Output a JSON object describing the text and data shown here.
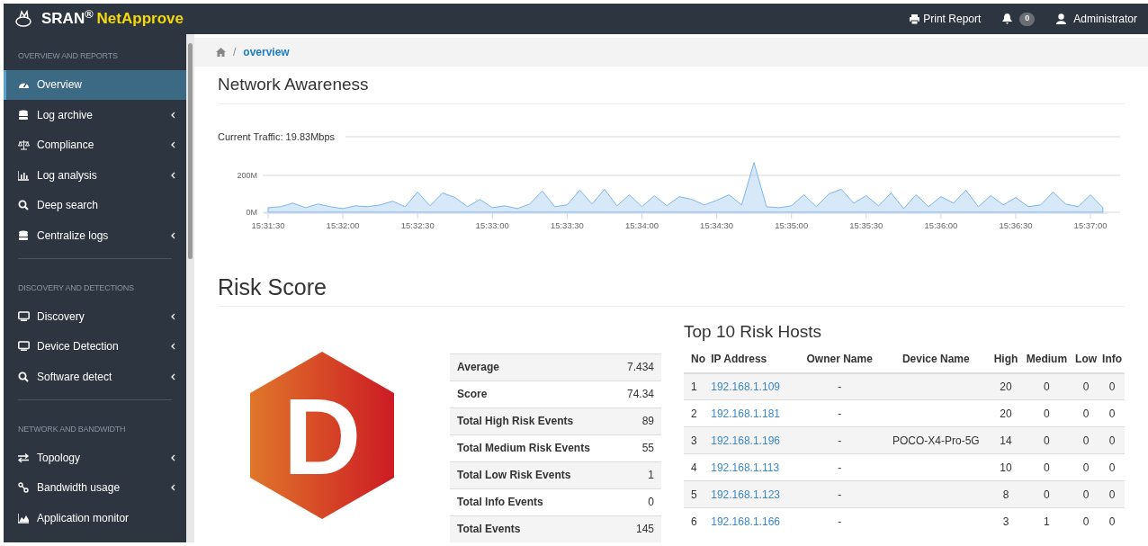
{
  "header": {
    "brand": "SRAN$^{®}$",
    "product": "NetApprove",
    "actions": [
      {
        "kind": "print",
        "label": "Print Report"
      },
      {
        "kind": "bell",
        "count": "0"
      },
      {
        "kind": "user",
        "label": "Administrator"
      }
    ]
  },
  "sidebar": {
    "items": [
      {
        "kind": "header",
        "label": "OVERVIEW AND REPORTS"
      },
      {
        "kind": "item",
        "label": "Overview",
        "selected": true,
        "submenu": false
      },
      {
        "kind": "item",
        "label": "Log archive",
        "selected": false,
        "submenu": true
      },
      {
        "kind": "item",
        "label": "Compliance",
        "selected": false,
        "submenu": true
      },
      {
        "kind": "item",
        "label": "Log analysis",
        "selected": false,
        "submenu": true
      },
      {
        "kind": "item",
        "label": "Deep search",
        "selected": false,
        "submenu": false
      },
      {
        "kind": "item",
        "label": "Centralize logs",
        "selected": false,
        "submenu": true
      },
      {
        "kind": "divider"
      },
      {
        "kind": "header",
        "label": "DISCOVERY AND DETECTIONS"
      },
      {
        "kind": "item",
        "label": "Discovery",
        "selected": false,
        "submenu": true
      },
      {
        "kind": "item",
        "label": "Device Detection",
        "selected": false,
        "submenu": true
      },
      {
        "kind": "item",
        "label": "Software detect",
        "selected": false,
        "submenu": true
      },
      {
        "kind": "divider"
      },
      {
        "kind": "header",
        "label": "NETWORK AND BANDWIDTH"
      },
      {
        "kind": "item",
        "label": "Topology",
        "selected": false,
        "submenu": true
      },
      {
        "kind": "item",
        "label": "Bandwidth usage",
        "selected": false,
        "submenu": true
      },
      {
        "kind": "item",
        "label": "Application monitor",
        "selected": false,
        "submenu": false
      }
    ]
  },
  "breadcrumb": {
    "separator": "/",
    "current": "overview"
  },
  "network": {
    "title": "Network Awareness",
    "chart_data": {
      "type": "area",
      "title": "Current Traffic: 19.83Mbps",
      "categories": [
        "15:31:30",
        null,
        null,
        null,
        null,
        null,
        "15:32:00",
        null,
        null,
        null,
        null,
        null,
        "15:32:30",
        null,
        null,
        null,
        null,
        null,
        "15:33:00",
        null,
        null,
        null,
        null,
        null,
        "15:33:30",
        null,
        null,
        null,
        null,
        null,
        "15:34:00",
        null,
        null,
        null,
        null,
        null,
        "15:34:30",
        null,
        null,
        null,
        null,
        null,
        "15:35:00",
        null,
        null,
        null,
        null,
        null,
        "15:35:30",
        null,
        null,
        null,
        null,
        null,
        "15:36:00",
        null,
        null,
        null,
        null,
        null,
        "15:36:30",
        null,
        null,
        null,
        null,
        null,
        "15:37:00",
        null
      ],
      "series": [
        {
          "color": "#7cb5ec",
          "values": [
            25,
            30,
            50,
            25,
            45,
            30,
            20,
            35,
            30,
            40,
            60,
            30,
            110,
            35,
            105,
            80,
            30,
            70,
            25,
            35,
            20,
            45,
            115,
            30,
            40,
            120,
            45,
            125,
            35,
            95,
            30,
            90,
            35,
            85,
            70,
            40,
            65,
            95,
            40,
            270,
            30,
            25,
            35,
            95,
            30,
            100,
            125,
            50,
            90,
            35,
            105,
            20,
            95,
            30,
            85,
            50,
            120,
            30,
            90,
            40,
            80,
            30,
            40,
            110,
            45,
            30,
            95,
            25
          ]
        }
      ],
      "ylim": [
        0,
        400
      ],
      "yticks": [
        {
          "value": 0,
          "label": "0M"
        },
        {
          "value": 200,
          "label": "200M"
        }
      ]
    }
  },
  "risk": {
    "title": "Risk Score",
    "grade": "D",
    "summary": [
      {
        "label": "Average",
        "value": "7.434"
      },
      {
        "label": "Score",
        "value": "74.34"
      },
      {
        "label": "Total High Risk Events",
        "value": "89"
      },
      {
        "label": "Total Medium Risk Events",
        "value": "55"
      },
      {
        "label": "Total Low Risk Events",
        "value": "1"
      },
      {
        "label": "Total Info Events",
        "value": "0"
      },
      {
        "label": "Total Events",
        "value": "145"
      }
    ],
    "hosts": {
      "title": "Top 10 Risk Hosts",
      "columns": [
        "No",
        "IP Address",
        "Owner Name",
        "Device Name",
        "High",
        "Medium",
        "Low",
        "Info"
      ],
      "rows": [
        [
          "1",
          "192.168.1.109",
          "-",
          "",
          "20",
          "0",
          "0",
          "0"
        ],
        [
          "2",
          "192.168.1.181",
          "-",
          "",
          "20",
          "0",
          "0",
          "0"
        ],
        [
          "3",
          "192.168.1.196",
          "-",
          "POCO-X4-Pro-5G",
          "14",
          "0",
          "0",
          "0"
        ],
        [
          "4",
          "192.168.1.113",
          "-",
          "",
          "10",
          "0",
          "0",
          "0"
        ],
        [
          "5",
          "192.168.1.123",
          "-",
          "",
          "8",
          "0",
          "0",
          "0"
        ],
        [
          "6",
          "192.168.1.166",
          "-",
          "",
          "3",
          "1",
          "0",
          "0"
        ]
      ]
    }
  }
}
